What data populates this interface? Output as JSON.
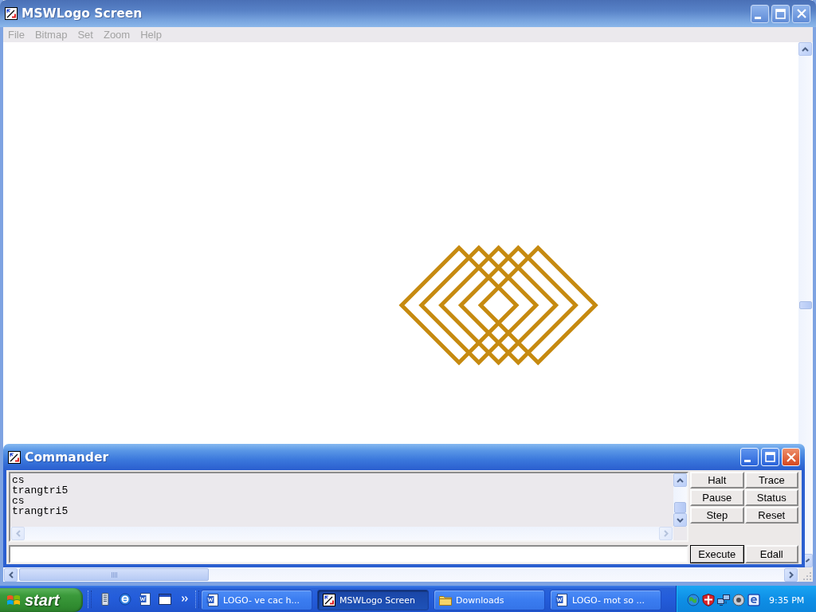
{
  "window": {
    "title": "MSWLogo Screen",
    "active": false
  },
  "menu": [
    "File",
    "Bitmap",
    "Set",
    "Zoom",
    "Help"
  ],
  "commander": {
    "title": "Commander",
    "active": true,
    "history": [
      "cs",
      "trangtri5",
      "cs",
      "trangtri5"
    ],
    "buttons": [
      "Halt",
      "Trace",
      "Pause",
      "Status",
      "Step",
      "Reset"
    ],
    "input_buttons": [
      {
        "label": "Execute",
        "default": true
      },
      {
        "label": "Edall",
        "default": false
      }
    ]
  },
  "taskbar": {
    "start": "start",
    "tasks": [
      {
        "label": "LOGO- ve cac h...",
        "kind": "document",
        "selected": false
      },
      {
        "label": "MSWLogo Screen",
        "kind": "program",
        "selected": true
      },
      {
        "label": "Downloads",
        "kind": "folder",
        "selected": false
      },
      {
        "label": "LOGO- mot so ...",
        "kind": "document",
        "selected": false
      }
    ],
    "clock": "9:35 PM"
  }
}
